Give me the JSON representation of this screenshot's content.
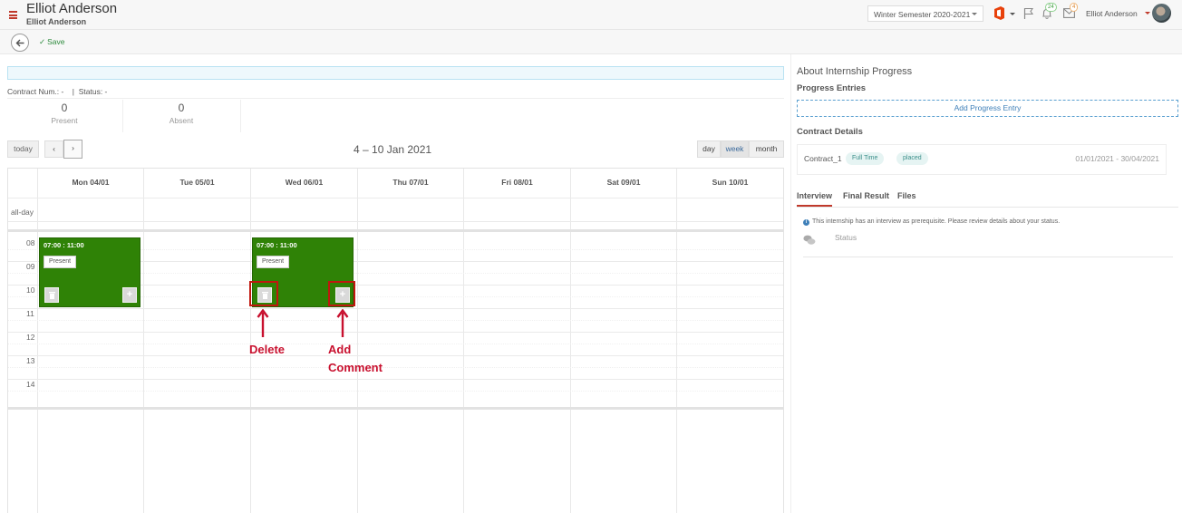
{
  "header": {
    "title": "Elliot Anderson",
    "subtitle": "Elliot Anderson",
    "semester": "Winter Semester 2020-2021",
    "bell_count": "24",
    "mail_count": "4",
    "user_name": "Elliot Anderson",
    "icons": [
      "menu-icon",
      "office-icon",
      "flag-icon",
      "bell-icon",
      "mail-icon",
      "avatar"
    ]
  },
  "toolbar": {
    "save_label": "Save"
  },
  "summary": {
    "contract_line": "Contract Num.: -    |  Status: -",
    "present_count": "0",
    "present_label": "Present",
    "absent_count": "0",
    "absent_label": "Absent"
  },
  "calendar": {
    "today_label": "today",
    "prev_label": "‹",
    "next_label": "›",
    "range_title": "4 – 10 Jan 2021",
    "views": {
      "day": "day",
      "week": "week",
      "month": "month"
    },
    "active_view": "week",
    "days": [
      "Mon 04/01",
      "Tue 05/01",
      "Wed 06/01",
      "Thu 07/01",
      "Fri 08/01",
      "Sat 09/01",
      "Sun 10/01"
    ],
    "allday_label": "all-day",
    "hours": [
      "08",
      "09",
      "10",
      "11",
      "12",
      "13",
      "14"
    ],
    "events": [
      {
        "day": "Mon 04/01",
        "time": "07:00 : 11:00",
        "status": "Present",
        "add_label": "+"
      },
      {
        "day": "Wed 06/01",
        "time": "07:00 : 11:00",
        "status": "Present",
        "add_label": "+"
      }
    ],
    "event_color": "#2f8206"
  },
  "annotations": {
    "delete": "Delete",
    "add_comment_line1": "Add",
    "add_comment_line2": "Comment",
    "color": "#c8102e"
  },
  "right_panel": {
    "about_title": "About Internship Progress",
    "progress_entries_title": "Progress Entries",
    "add_entry_label": "Add Progress Entry",
    "contract_details_title": "Contract Details",
    "contract": {
      "name": "Contract_1",
      "type": "Full Time",
      "state": "placed",
      "dates": "01/01/2021 - 30/04/2021"
    },
    "tabs": [
      "Interview",
      "Final Result",
      "Files"
    ],
    "active_tab": "Interview",
    "interview_note": "This internship has an interview as prerequisite. Please review details about your status.",
    "status_label": "Status"
  }
}
